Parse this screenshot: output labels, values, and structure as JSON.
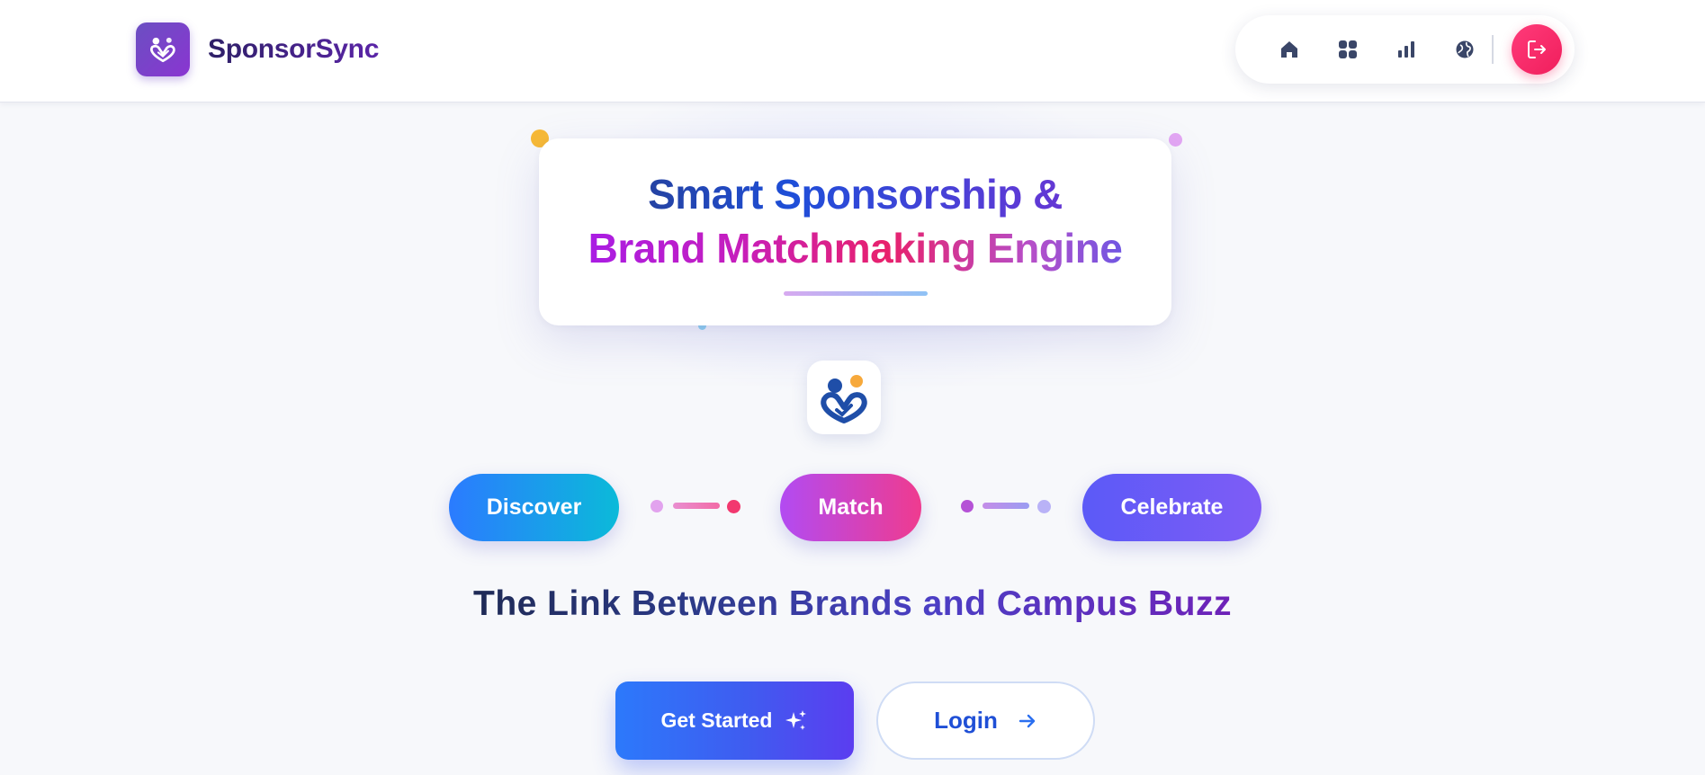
{
  "header": {
    "brand_name": "SponsorSync",
    "nav": [
      {
        "name": "home-icon"
      },
      {
        "name": "grid-icon"
      },
      {
        "name": "bar-chart-icon"
      },
      {
        "name": "globe-icon"
      }
    ],
    "logout": {
      "name": "logout-icon"
    }
  },
  "hero": {
    "title_line1": "Smart Sponsorship &",
    "title_line2": "Brand Matchmaking Engine"
  },
  "steps": {
    "discover": "Discover",
    "match": "Match",
    "celebrate": "Celebrate"
  },
  "tagline": "The Link Between Brands and Campus Buzz",
  "cta": {
    "get_started": "Get Started",
    "login": "Login"
  },
  "colors": {
    "accent_blue": "#2b7bff",
    "accent_pink": "#ef3b8f",
    "accent_purple": "#6b4fc2",
    "logout_red": "#f01e5c"
  }
}
